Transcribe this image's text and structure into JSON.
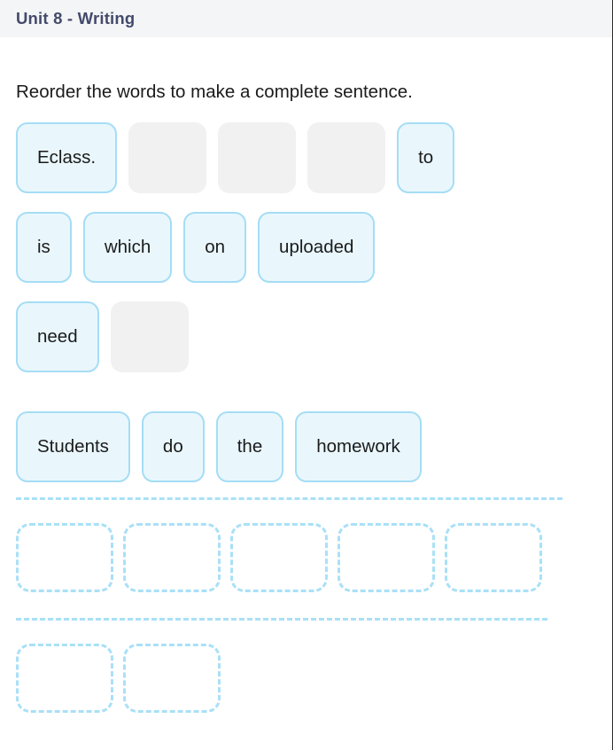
{
  "header": {
    "title": "Unit 8 - Writing",
    "background_color": "#f4f5f6",
    "text_color": "#434a6b"
  },
  "instruction": {
    "text": "Reorder the words to make a complete sentence."
  },
  "colors": {
    "tile_fill": "#e9f7fd",
    "tile_border": "#a5ddf5",
    "placeholder_fill": "#f1f1f1",
    "dashed_border": "#a9e0f7",
    "text": "#1b1b1b"
  },
  "word_bank": {
    "rows": [
      {
        "tiles": [
          {
            "label": "Eclass.",
            "type": "word"
          },
          {
            "label": "",
            "type": "placeholder"
          },
          {
            "label": "",
            "type": "placeholder"
          },
          {
            "label": "",
            "type": "placeholder"
          },
          {
            "label": "to",
            "type": "word"
          }
        ]
      },
      {
        "tiles": [
          {
            "label": "is",
            "type": "word"
          },
          {
            "label": "which",
            "type": "word"
          },
          {
            "label": "on",
            "type": "word"
          },
          {
            "label": "uploaded",
            "type": "word"
          }
        ]
      },
      {
        "tiles": [
          {
            "label": "need",
            "type": "word"
          },
          {
            "label": "",
            "type": "placeholder"
          }
        ]
      },
      {
        "tiles": [
          {
            "label": "Students",
            "type": "word"
          },
          {
            "label": "do",
            "type": "word"
          },
          {
            "label": "the",
            "type": "word"
          },
          {
            "label": "homework",
            "type": "word"
          }
        ]
      }
    ]
  },
  "answer_area": {
    "lines": [
      {
        "slot_count": 5
      },
      {
        "slot_count": 2
      }
    ]
  }
}
